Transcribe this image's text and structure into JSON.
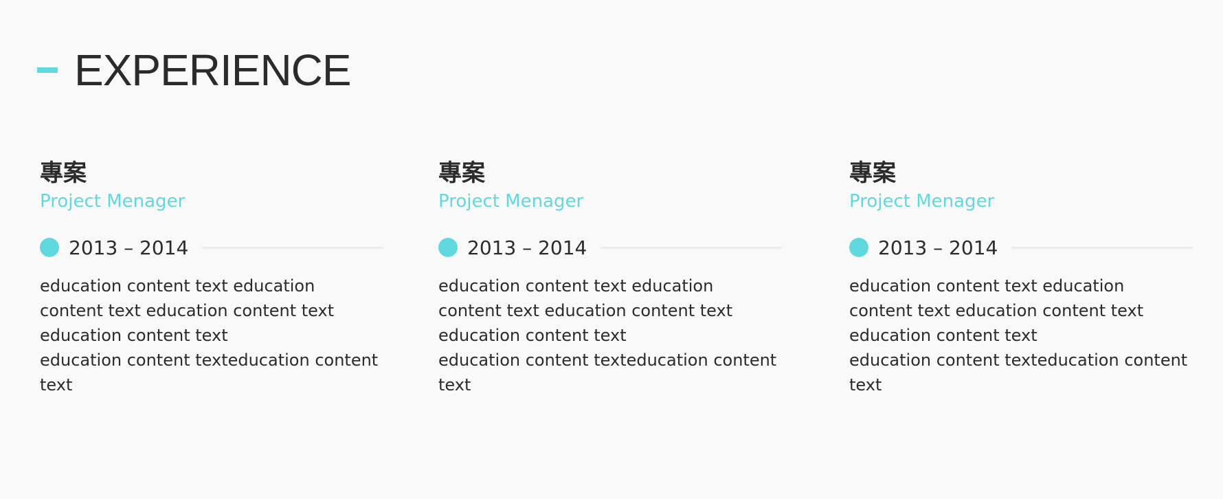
{
  "header": {
    "title": "EXPERIENCE"
  },
  "colors": {
    "accent": "#5fd9dd",
    "text": "#2b2b2b",
    "background": "#f9f9f9",
    "divider": "#ececec"
  },
  "items": [
    {
      "title": "專案",
      "role": "Project Menager",
      "date": "2013 – 2014",
      "desc_lines": [
        "education content text education",
        "content text education content text",
        "education content text",
        "education content texteducation content",
        "text"
      ]
    },
    {
      "title": "專案",
      "role": "Project Menager",
      "date": "2013 – 2014",
      "desc_lines": [
        "education content text education",
        "content text education content text",
        "education content text",
        "education content texteducation content",
        "text"
      ]
    },
    {
      "title": "專案",
      "role": "Project Menager",
      "date": "2013 – 2014",
      "desc_lines": [
        "education content text education",
        "content text education content text",
        "education content text",
        "education content texteducation content",
        "text"
      ]
    }
  ]
}
